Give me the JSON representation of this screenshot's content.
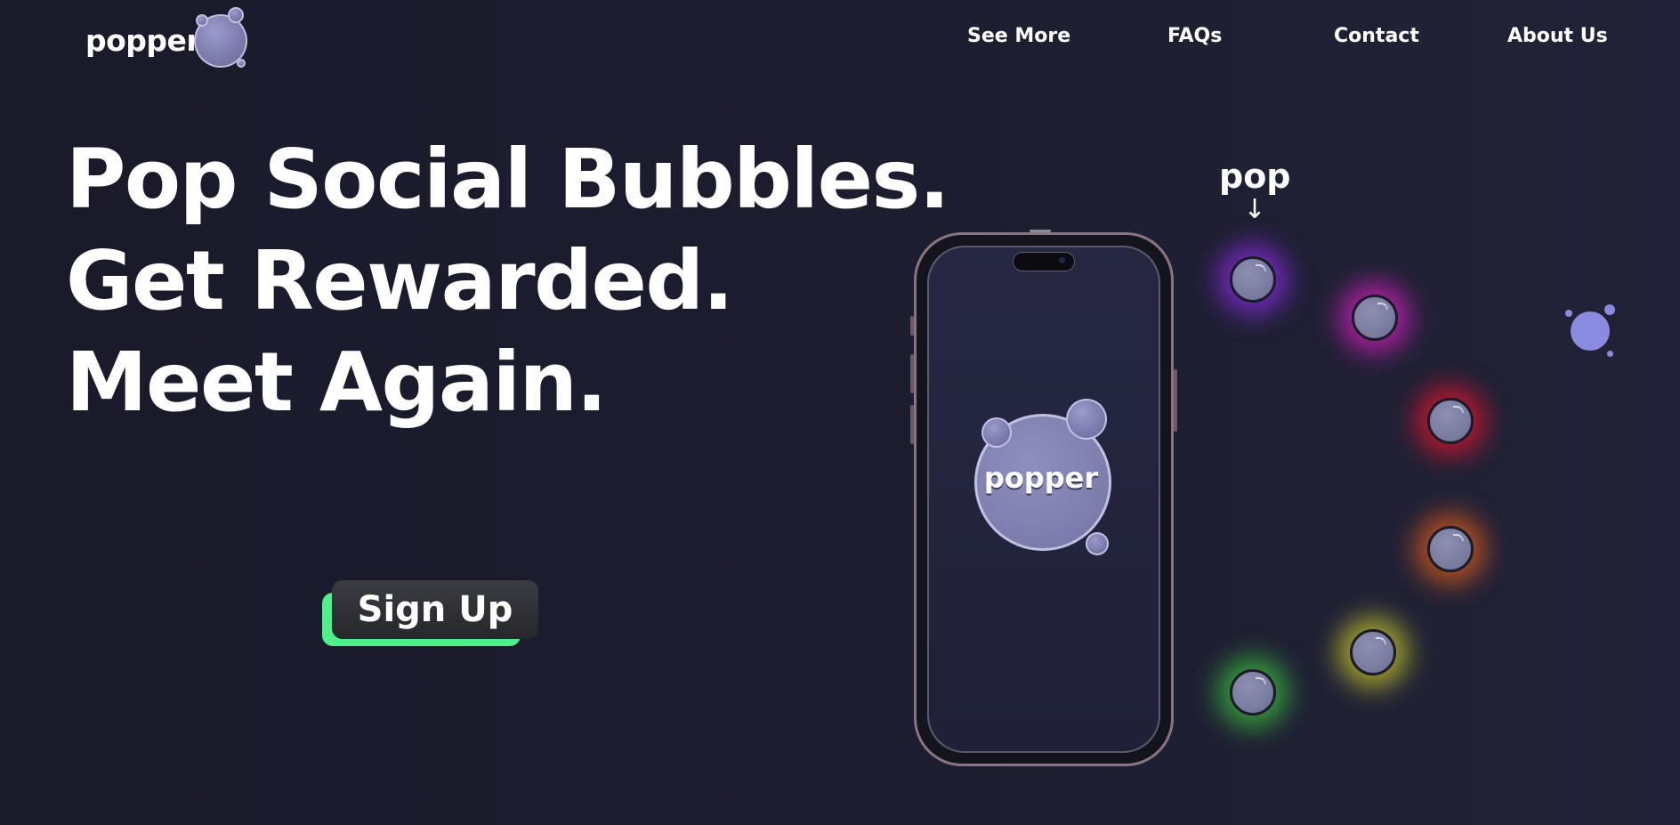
{
  "header": {
    "logo_text": "popper",
    "nav": [
      "See More",
      "FAQs",
      "Contact",
      "About Us"
    ]
  },
  "hero": {
    "lines": [
      "Pop Social Bubbles.",
      "Get Rewarded.",
      "Meet Again."
    ],
    "signup_label": "Sign Up"
  },
  "phone": {
    "app_logo_text": "popper"
  },
  "bubbles": {
    "pop_label": "pop",
    "arrow": "↓",
    "glow_colors": [
      "#8a2be2",
      "#e020c8",
      "#e0142c",
      "#e86018",
      "#e0e028",
      "#3ccc3c"
    ]
  },
  "colors": {
    "accent_green": "#4ef08a",
    "bubble_lavender": "#8a8bc0",
    "background": "#1c1d2f"
  }
}
